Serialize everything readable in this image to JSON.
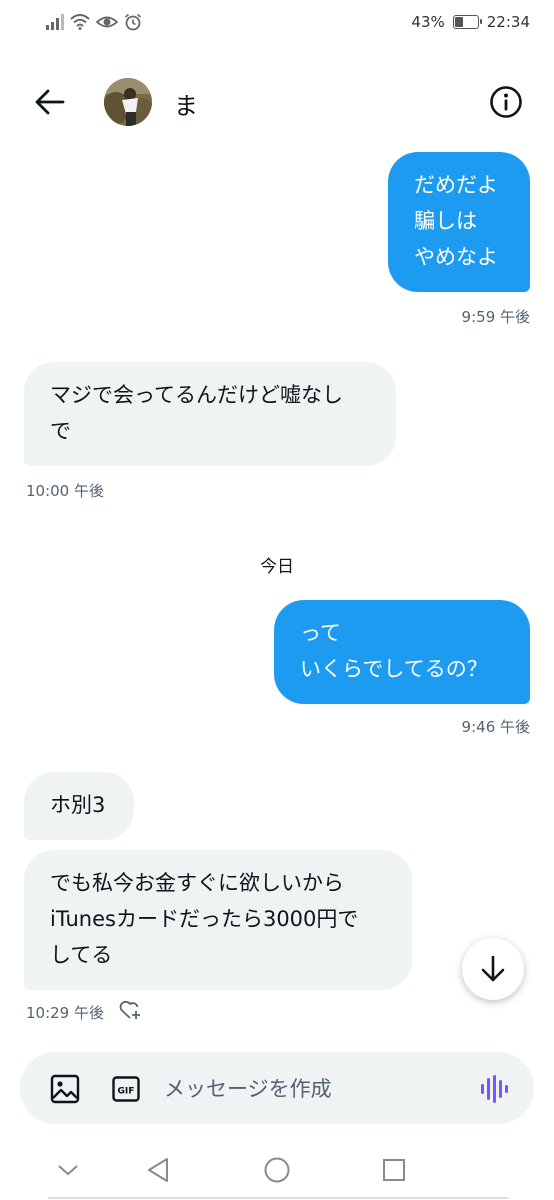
{
  "status_bar": {
    "battery_percent": "43%",
    "battery_level": 0.43,
    "time": "22:34",
    "left_icons": [
      "signal-icon",
      "wifi-icon",
      "eye-icon",
      "alarm-icon"
    ]
  },
  "header": {
    "name": "ま",
    "back_icon": "back-arrow-icon",
    "info_icon": "info-icon"
  },
  "messages": [
    {
      "direction": "sent",
      "lines": [
        "だめだよ",
        "騙しは",
        "やめなよ"
      ],
      "time": "9:59 午後"
    },
    {
      "direction": "received",
      "lines": [
        "マジで会ってるんだけど嘘なし",
        "で"
      ],
      "time": "10:00 午後"
    },
    {
      "direction": "separator",
      "label": "今日"
    },
    {
      "direction": "sent",
      "lines": [
        "って",
        "いくらでしてるの？"
      ],
      "time": "9:46 午後"
    },
    {
      "direction": "received",
      "lines": [
        "ホ別3"
      ]
    },
    {
      "direction": "received",
      "lines": [
        "でも私今お金すぐに欲しいから",
        "iTunesカードだったら3000円で",
        "してる"
      ],
      "time": "10:29 午後"
    }
  ],
  "composer": {
    "placeholder": "メッセージを作成",
    "media_icon": "image-icon",
    "gif_label": "GIF",
    "voice_icon": "voice-wave-icon"
  },
  "colors": {
    "accent": "#1d9bf0",
    "received_bubble": "#eff3f4",
    "voice_accent": "#7856ff"
  },
  "nav": {
    "icons": [
      "chevron-down-icon",
      "back-triangle-icon",
      "home-circle-icon",
      "recents-square-icon"
    ]
  }
}
